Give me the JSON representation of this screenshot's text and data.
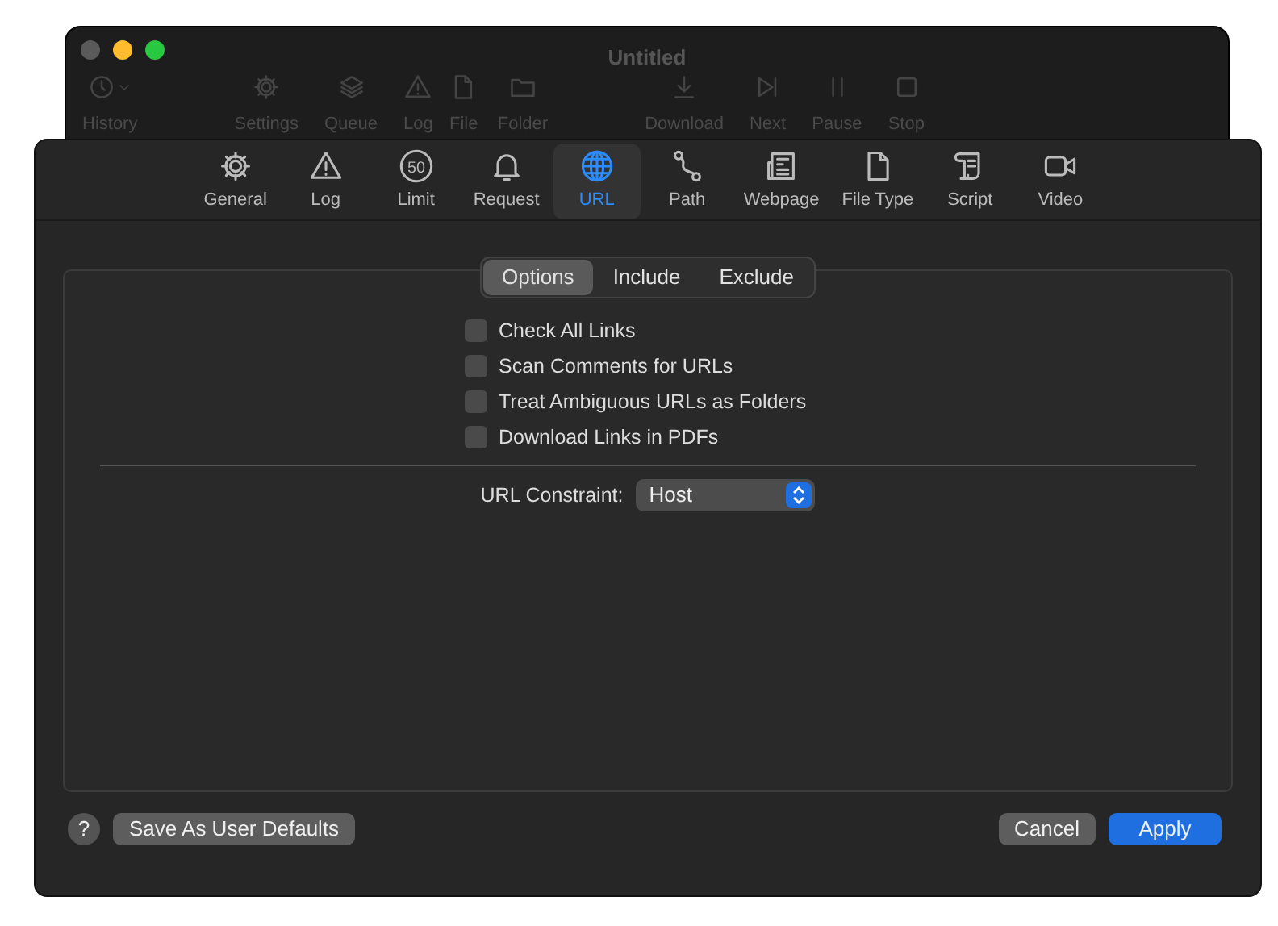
{
  "background_window": {
    "title": "Untitled",
    "toolbar": [
      {
        "label": "History",
        "kind": "history"
      },
      {
        "label": "Settings",
        "kind": "gear"
      },
      {
        "label": "Queue",
        "kind": "stack"
      },
      {
        "label": "Log",
        "kind": "warning"
      },
      {
        "label": "File",
        "kind": "file"
      },
      {
        "label": "Folder",
        "kind": "folder"
      },
      {
        "label": "Download",
        "kind": "download"
      },
      {
        "label": "Next",
        "kind": "next"
      },
      {
        "label": "Pause",
        "kind": "pause"
      },
      {
        "label": "Stop",
        "kind": "stop"
      }
    ]
  },
  "tabs": [
    {
      "label": "General",
      "kind": "gear",
      "selected": false
    },
    {
      "label": "Log",
      "kind": "warning",
      "selected": false
    },
    {
      "label": "Limit",
      "kind": "limit",
      "badge": "50",
      "selected": false
    },
    {
      "label": "Request",
      "kind": "bell",
      "selected": false
    },
    {
      "label": "URL",
      "kind": "globe",
      "selected": true
    },
    {
      "label": "Path",
      "kind": "path",
      "selected": false
    },
    {
      "label": "Webpage",
      "kind": "newspaper",
      "selected": false
    },
    {
      "label": "File Type",
      "kind": "file",
      "selected": false
    },
    {
      "label": "Script",
      "kind": "scroll",
      "selected": false
    },
    {
      "label": "Video",
      "kind": "video",
      "selected": false
    }
  ],
  "segments": [
    {
      "label": "Options",
      "selected": true
    },
    {
      "label": "Include",
      "selected": false
    },
    {
      "label": "Exclude",
      "selected": false
    }
  ],
  "options": [
    {
      "label": "Check All Links",
      "checked": false
    },
    {
      "label": "Scan Comments for URLs",
      "checked": false
    },
    {
      "label": "Treat Ambiguous URLs as Folders",
      "checked": false
    },
    {
      "label": "Download Links in PDFs",
      "checked": false
    }
  ],
  "url_constraint": {
    "label": "URL Constraint:",
    "value": "Host"
  },
  "footer": {
    "help": "?",
    "save_defaults": "Save As User Defaults",
    "cancel": "Cancel",
    "apply": "Apply"
  }
}
